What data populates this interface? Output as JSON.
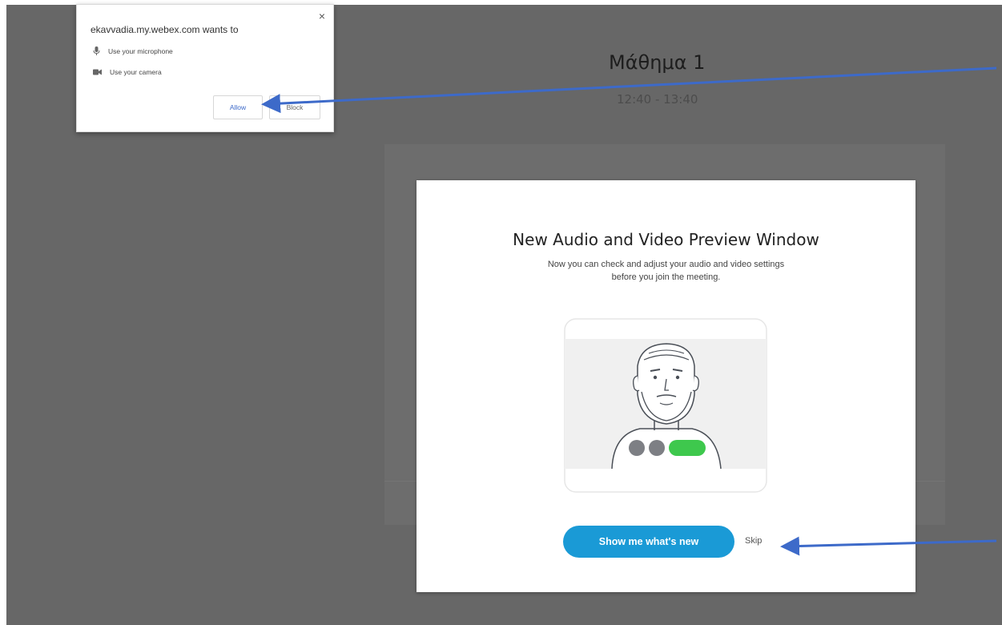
{
  "meeting": {
    "title": "Μάθημα 1",
    "time": "12:40 - 13:40"
  },
  "modal": {
    "title": "New Audio and Video Preview Window",
    "description_line1": "Now you can check and adjust your audio and video settings",
    "description_line2": "before you join the meeting.",
    "primary_button": "Show me what's new",
    "skip_label": "Skip"
  },
  "permission_prompt": {
    "origin_text": "ekavvadia.my.webex.com wants to",
    "close_glyph": "×",
    "items": [
      {
        "icon": "microphone-icon",
        "label": "Use your microphone"
      },
      {
        "icon": "camera-icon",
        "label": "Use your camera"
      }
    ],
    "allow_label": "Allow",
    "block_label": "Block"
  },
  "colors": {
    "background": "#676767",
    "primary_button": "#1a9ad6",
    "annotation_arrow": "#3d6ac9",
    "toggle_on": "#3ec84d"
  }
}
